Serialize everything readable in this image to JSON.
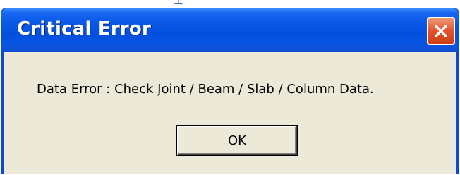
{
  "dialog": {
    "title": "Critical Error",
    "message": "Data Error : Check Joint / Beam / Slab / Column Data.",
    "ok_label": "OK",
    "close_icon": "close-icon"
  },
  "colors": {
    "titlebar": "#0450de",
    "client": "#ece9d8",
    "close_button": "#e4572e"
  }
}
